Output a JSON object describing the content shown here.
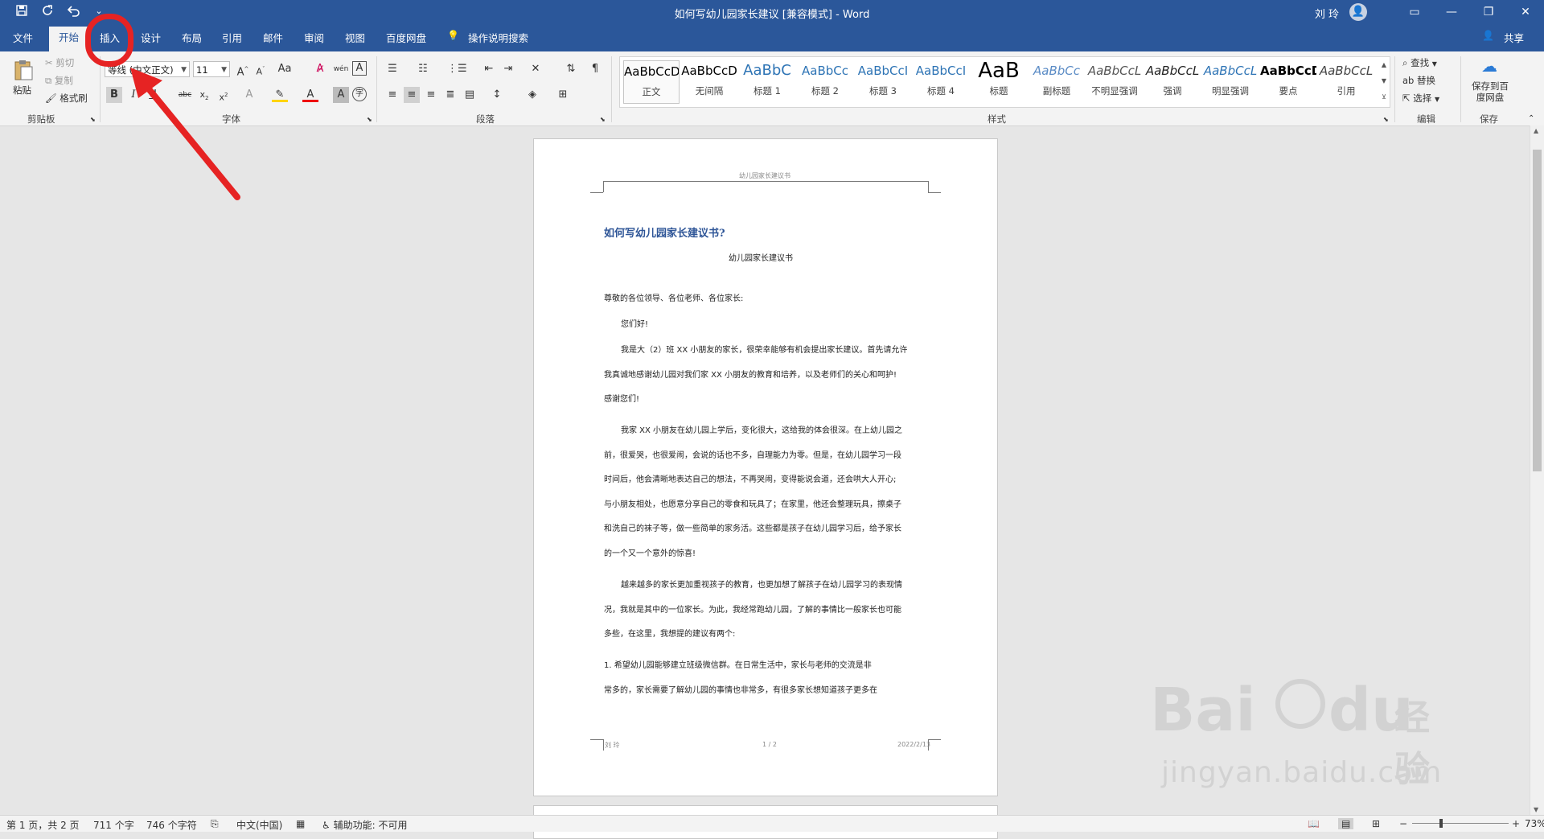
{
  "title_bar": {
    "document_title": "如何写幼儿园家长建议 [兼容模式]  -  Word",
    "user_name": "刘 玲",
    "qat": [
      "save-icon",
      "autosave-icon",
      "undo-icon",
      "redo-icon"
    ]
  },
  "tabs": [
    {
      "id": "file",
      "label": "文件"
    },
    {
      "id": "home",
      "label": "开始"
    },
    {
      "id": "insert",
      "label": "插入"
    },
    {
      "id": "design",
      "label": "设计"
    },
    {
      "id": "layout",
      "label": "布局"
    },
    {
      "id": "references",
      "label": "引用"
    },
    {
      "id": "mailings",
      "label": "邮件"
    },
    {
      "id": "review",
      "label": "审阅"
    },
    {
      "id": "view",
      "label": "视图"
    },
    {
      "id": "baidu",
      "label": "百度网盘"
    }
  ],
  "tell_me": "操作说明搜索",
  "share": "共享",
  "ribbon": {
    "clipboard": {
      "paste": "粘贴",
      "cut": "剪切",
      "copy": "复制",
      "format_painter": "格式刷",
      "label": "剪贴板"
    },
    "font": {
      "font_name": "等线 (中文正文)",
      "font_size": "11",
      "label": "字体"
    },
    "paragraph": {
      "label": "段落"
    },
    "styles": {
      "label": "样式",
      "items": [
        {
          "sample": "AaBbCcD",
          "name": "正文",
          "color": "#000000"
        },
        {
          "sample": "AaBbCcD",
          "name": "无间隔",
          "color": "#000000"
        },
        {
          "sample": "AaBbC",
          "name": "标题 1",
          "color": "#2e74b5"
        },
        {
          "sample": "AaBbCc",
          "name": "标题 2",
          "color": "#2e74b5"
        },
        {
          "sample": "AaBbCcI",
          "name": "标题 3",
          "color": "#2e74b5"
        },
        {
          "sample": "AaBbCcI",
          "name": "标题 4",
          "color": "#2e74b5"
        },
        {
          "sample": "AaB",
          "name": "标题",
          "color": "#000000"
        },
        {
          "sample": "AaBbCc",
          "name": "副标题",
          "color": "#5a8bc5"
        },
        {
          "sample": "AaBbCcL",
          "name": "不明显强调",
          "color": "#555555"
        },
        {
          "sample": "AaBbCcL",
          "name": "强调",
          "color": "#222222"
        },
        {
          "sample": "AaBbCcL",
          "name": "明显强调",
          "color": "#2e74b5"
        },
        {
          "sample": "AaBbCcD",
          "name": "要点",
          "color": "#000000"
        },
        {
          "sample": "AaBbCcL",
          "name": "引用",
          "color": "#444444"
        }
      ]
    },
    "editing": {
      "find": "查找",
      "replace": "替换",
      "select": "选择",
      "label": "编辑"
    },
    "save": {
      "button": "保存到百度网盘",
      "label": "保存"
    }
  },
  "document": {
    "header_text": "幼儿园家长建议书",
    "heading": "如何写幼儿园家长建议书?",
    "subtitle": "幼儿园家长建议书",
    "paragraphs": [
      "尊敬的各位领导、各位老师、各位家长:",
      "您们好!",
      "我是大（2）班 XX 小朋友的家长，很荣幸能够有机会提出家长建议。首先请允许",
      "我真诚地感谢幼儿园对我们家 XX 小朋友的教育和培养，以及老师们的关心和呵护!",
      "感谢您们!",
      "我家 XX 小朋友在幼儿园上学后，变化很大，这给我的体会很深。在上幼儿园之",
      "前，很爱哭，也很爱闹，会说的话也不多，自理能力为零。但是，在幼儿园学习一段",
      "时间后，他会清晰地表达自己的想法，不再哭闹，变得能说会道，还会哄大人开心;",
      "与小朋友相处，也愿意分享自己的零食和玩具了；在家里，他还会整理玩具，擦桌子",
      "和洗自己的袜子等，做一些简单的家务活。这些都是孩子在幼儿园学习后，给予家长",
      "的一个又一个意外的惊喜!",
      "越来越多的家长更加重视孩子的教育，也更加想了解孩子在幼儿园学习的表现情",
      "况，我就是其中的一位家长。为此，我经常跑幼儿园，了解的事情比一般家长也可能",
      "多些，在这里，我想提的建议有两个:",
      "1.     希望幼儿园能够建立班级微信群。在日常生活中，家长与老师的交流是非",
      "常多的，家长需要了解幼儿园的事情也非常多，有很多家长想知道孩子更多在"
    ],
    "footer_left": "刘 玲",
    "footer_center": "1 / 2",
    "footer_right": "2022/2/13"
  },
  "status_bar": {
    "page": "第 1 页，共 2 页",
    "words": "711 个字",
    "chars": "746 个字符",
    "language": "中文(中国)",
    "accessibility": "辅助功能: 不可用",
    "zoom": "73%"
  },
  "watermark": {
    "brand": "Bai",
    "brand2": "du",
    "suffix": "经验",
    "url": "jingyan.baidu.com"
  },
  "colors": {
    "word_blue": "#2b579a",
    "annotation_red": "#e62323"
  }
}
